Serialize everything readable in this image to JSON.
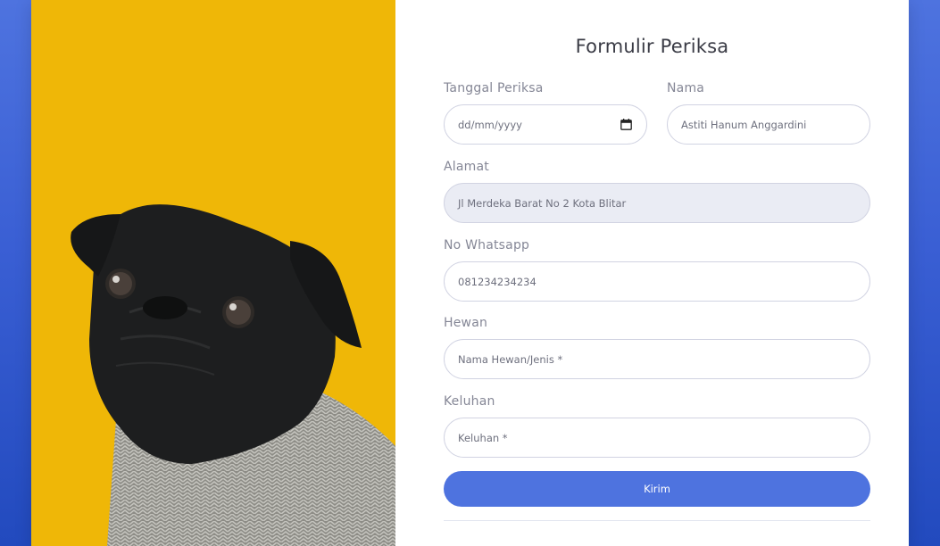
{
  "form": {
    "title": "Formulir Periksa",
    "tanggal": {
      "label": "Tanggal Periksa",
      "value": "dd/mm/yyyy"
    },
    "nama": {
      "label": "Nama",
      "value": "Astiti Hanum Anggardini"
    },
    "alamat": {
      "label": "Alamat",
      "value": "Jl Merdeka Barat No 2 Kota Blitar"
    },
    "whatsapp": {
      "label": "No Whatsapp",
      "value": "081234234234"
    },
    "hewan": {
      "label": "Hewan",
      "placeholder": "Nama Hewan/Jenis *"
    },
    "keluhan": {
      "label": "Keluhan",
      "placeholder": "Keluhan *"
    },
    "submit_label": "Kirim"
  },
  "colors": {
    "accent": "#4e73df",
    "image_background": "#efb707"
  },
  "icons": {
    "date": "calendar-icon"
  }
}
